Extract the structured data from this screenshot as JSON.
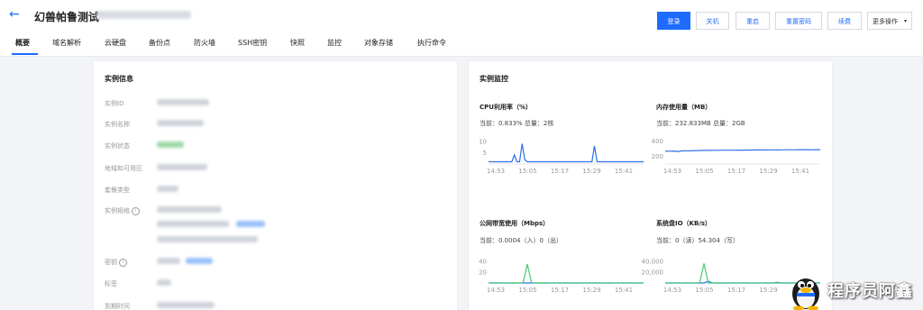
{
  "header": {
    "title": "幻兽帕鲁测试",
    "actions": [
      {
        "label": "登录",
        "name": "login-button",
        "primary": true
      },
      {
        "label": "关机",
        "name": "shutdown-button"
      },
      {
        "label": "重启",
        "name": "restart-button"
      },
      {
        "label": "重置密码",
        "name": "reset-password-button"
      },
      {
        "label": "续费",
        "name": "renew-button"
      },
      {
        "label": "更多操作",
        "name": "more-actions-button",
        "dropdown": true
      }
    ]
  },
  "tabs": [
    "概要",
    "域名解析",
    "云硬盘",
    "备份点",
    "防火墙",
    "SSH密钥",
    "快照",
    "监控",
    "对象存储",
    "执行命令"
  ],
  "instance_info": {
    "title": "实例信息",
    "labels": {
      "id": "实例ID",
      "name": "实例名称",
      "status": "实例状态",
      "region": "地域和可用区",
      "package": "套餐类型",
      "spec": "实例规格",
      "key": "密钥",
      "tags": "标签",
      "expire": "到期时间"
    }
  },
  "monitor": {
    "title": "实例监控",
    "charts": [
      {
        "name": "cpu-chart",
        "title": "CPU利用率（%）",
        "current": "当前：0.833% 总量：2核",
        "chart_data": {
          "type": "line",
          "title": "CPU利用率（%）",
          "categories": [
            "14:53",
            "15:05",
            "15:17",
            "15:29",
            "15:41"
          ],
          "y_ticks": [
            5,
            10
          ],
          "ylim": [
            0,
            12
          ],
          "series": [
            {
              "values": [
                1,
                1,
                1,
                1,
                1,
                1,
                1,
                1,
                1,
                1,
                4,
                1,
                1,
                9,
                2,
                1,
                1,
                1,
                1,
                1,
                1,
                1,
                1,
                1,
                1,
                1,
                1,
                1,
                1,
                1,
                1,
                1,
                1,
                1,
                1,
                1,
                1,
                1,
                1,
                1,
                1,
                8,
                1,
                1,
                1,
                1,
                1,
                1,
                1,
                1,
                1,
                1,
                1,
                1,
                1,
                1,
                1,
                1,
                1,
                1,
                1
              ]
            }
          ],
          "color": "#2d6fe8"
        }
      },
      {
        "name": "memory-chart",
        "title": "内存使用量（MB）",
        "current": "当前：232.833MB 总量：2GB",
        "chart_data": {
          "type": "line",
          "title": "内存使用量（MB）",
          "categories": [
            "14:53",
            "15:05",
            "15:17",
            "15:29",
            "15:41"
          ],
          "y_ticks": [
            200,
            400
          ],
          "ylim": [
            100,
            450
          ],
          "series": [
            {
              "values": [
                268,
                266,
                268,
                262,
                270,
                272,
                270,
                274,
                275,
                276,
                276,
                277,
                277,
                278,
                278,
                278,
                279,
                280,
                280,
                281,
                281,
                282,
                282,
                282,
                283,
                283,
                282,
                283,
                284,
                284,
                284,
                285,
                285,
                285,
                284,
                285,
                285
              ]
            }
          ],
          "color": "#2d6fe8"
        }
      },
      {
        "name": "bandwidth-chart",
        "title": "公网带宽使用（Mbps）",
        "current": "当前：0.0004（入）0（出）",
        "chart_data": {
          "type": "line",
          "title": "公网带宽使用（Mbps）",
          "categories": [
            "14:53",
            "15:05",
            "15:17",
            "15:29",
            "15:41"
          ],
          "y_ticks": [
            20,
            40
          ],
          "ylim": [
            0,
            50
          ],
          "series": [
            {
              "values": [
                0,
                0,
                0,
                0,
                0,
                0,
                0,
                0,
                0,
                0,
                0,
                0,
                0,
                0,
                0,
                0,
                0,
                0,
                0,
                0,
                0,
                0,
                0,
                0,
                0,
                0,
                0,
                0,
                0,
                0,
                0,
                0,
                0,
                0,
                0,
                0,
                0
              ],
              "color": "#2d6fe8"
            },
            {
              "values": [
                0,
                0,
                0,
                0,
                0,
                0,
                0,
                0,
                0,
                35,
                0,
                0,
                0,
                0,
                0,
                0,
                0,
                0,
                0,
                0,
                0,
                0,
                0,
                0,
                0,
                0,
                0,
                0,
                0,
                0,
                0,
                0,
                0,
                0,
                0,
                0,
                0
              ],
              "color": "#46c77a"
            }
          ]
        }
      },
      {
        "name": "disk-io-chart",
        "title": "系统盘IO（KB/s）",
        "current": "当前：0（读）54.304（写）",
        "chart_data": {
          "type": "line",
          "title": "系统盘IO（KB/s）",
          "categories": [
            "14:53",
            "15:05",
            "15:17",
            "15:29",
            "15:41"
          ],
          "y_ticks": [
            20000,
            40000
          ],
          "ylim": [
            0,
            50000
          ],
          "y_tick_labels": [
            "20,000",
            "40,000"
          ],
          "series": [
            {
              "values": [
                0,
                0,
                0,
                0,
                0,
                0,
                0,
                0,
                0,
                0,
                3000,
                0,
                0,
                0,
                0,
                0,
                0,
                0,
                0,
                0,
                0,
                0,
                0,
                0,
                0,
                0,
                1000,
                0,
                0,
                0,
                0,
                0,
                0,
                0,
                0,
                0,
                0
              ],
              "color": "#2d6fe8"
            },
            {
              "values": [
                0,
                0,
                0,
                0,
                0,
                0,
                0,
                0,
                0,
                36000,
                0,
                0,
                0,
                0,
                0,
                0,
                0,
                0,
                0,
                0,
                0,
                0,
                0,
                0,
                0,
                0,
                0,
                0,
                0,
                0,
                0,
                0,
                0,
                0,
                0,
                0,
                0
              ],
              "color": "#46c77a"
            }
          ]
        }
      }
    ]
  },
  "watermark": {
    "text": "程序员阿鑫"
  }
}
